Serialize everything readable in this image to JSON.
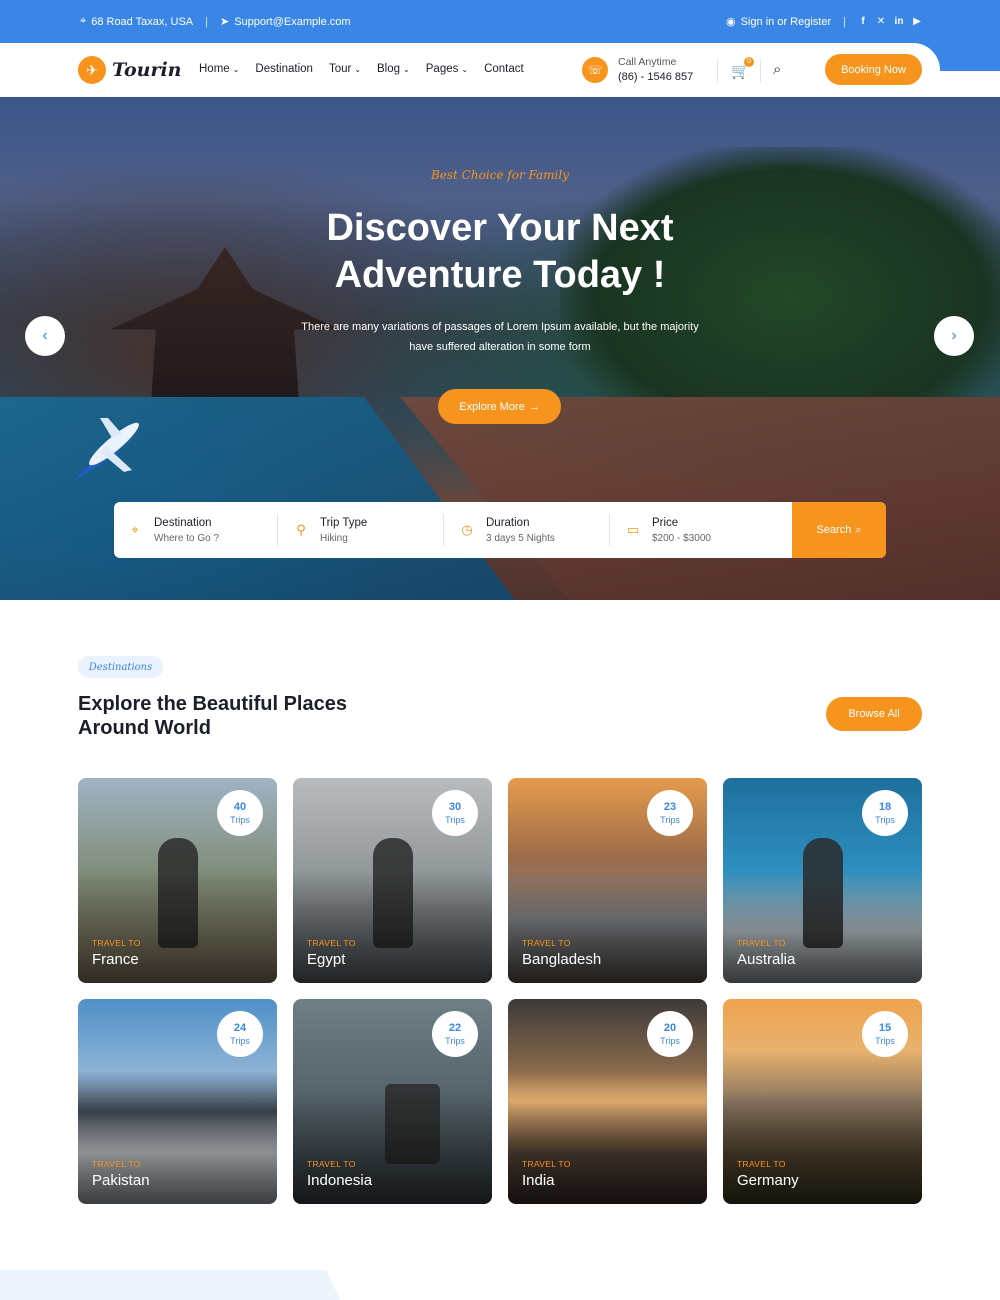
{
  "topbar": {
    "address": "68 Road Taxax, USA",
    "email": "Support@Example.com",
    "signin": "Sign in or Register",
    "social": [
      "facebook-icon",
      "x-icon",
      "linkedin-icon",
      "youtube-icon"
    ]
  },
  "nav": {
    "brand": "Tourin",
    "menu": [
      {
        "label": "Home",
        "dropdown": true
      },
      {
        "label": "Destination",
        "dropdown": false
      },
      {
        "label": "Tour",
        "dropdown": true
      },
      {
        "label": "Blog",
        "dropdown": true
      },
      {
        "label": "Pages",
        "dropdown": true
      },
      {
        "label": "Contact",
        "dropdown": false
      }
    ],
    "call_label": "Call Anytime",
    "call_number": "(86) - 1546 857",
    "cart_count": "0",
    "booking": "Booking Now"
  },
  "hero": {
    "tagline": "Best Choice for Family",
    "title_line1": "Discover Your Next",
    "title_line2": "Adventure Today !",
    "subtitle": "There are many variations of passages of Lorem Ipsum available, but the majority have suffered alteration in some form",
    "cta": "Explore More"
  },
  "search": {
    "fields": [
      {
        "label": "Destination",
        "value": "Where to Go ?",
        "icon": "map-pin-icon"
      },
      {
        "label": "Trip Type",
        "value": "Hiking",
        "icon": "hiker-icon"
      },
      {
        "label": "Duration",
        "value": "3 days 5 Nights",
        "icon": "clock-icon"
      },
      {
        "label": "Price",
        "value": "$200 - $3000",
        "icon": "card-icon"
      }
    ],
    "button": "Search"
  },
  "destinations": {
    "chip": "Destinations",
    "title": "Explore the Beautiful Places Around World",
    "browse": "Browse All",
    "travel_to": "TRAVEL TO",
    "trips_label": "Trips",
    "cards": [
      {
        "name": "France",
        "trips": "40"
      },
      {
        "name": "Egypt",
        "trips": "30"
      },
      {
        "name": "Bangladesh",
        "trips": "23"
      },
      {
        "name": "Australia",
        "trips": "18"
      },
      {
        "name": "Pakistan",
        "trips": "24"
      },
      {
        "name": "Indonesia",
        "trips": "22"
      },
      {
        "name": "India",
        "trips": "20"
      },
      {
        "name": "Germany",
        "trips": "15"
      }
    ]
  },
  "colors": {
    "primary": "#3a86e6",
    "accent": "#f7941d"
  }
}
